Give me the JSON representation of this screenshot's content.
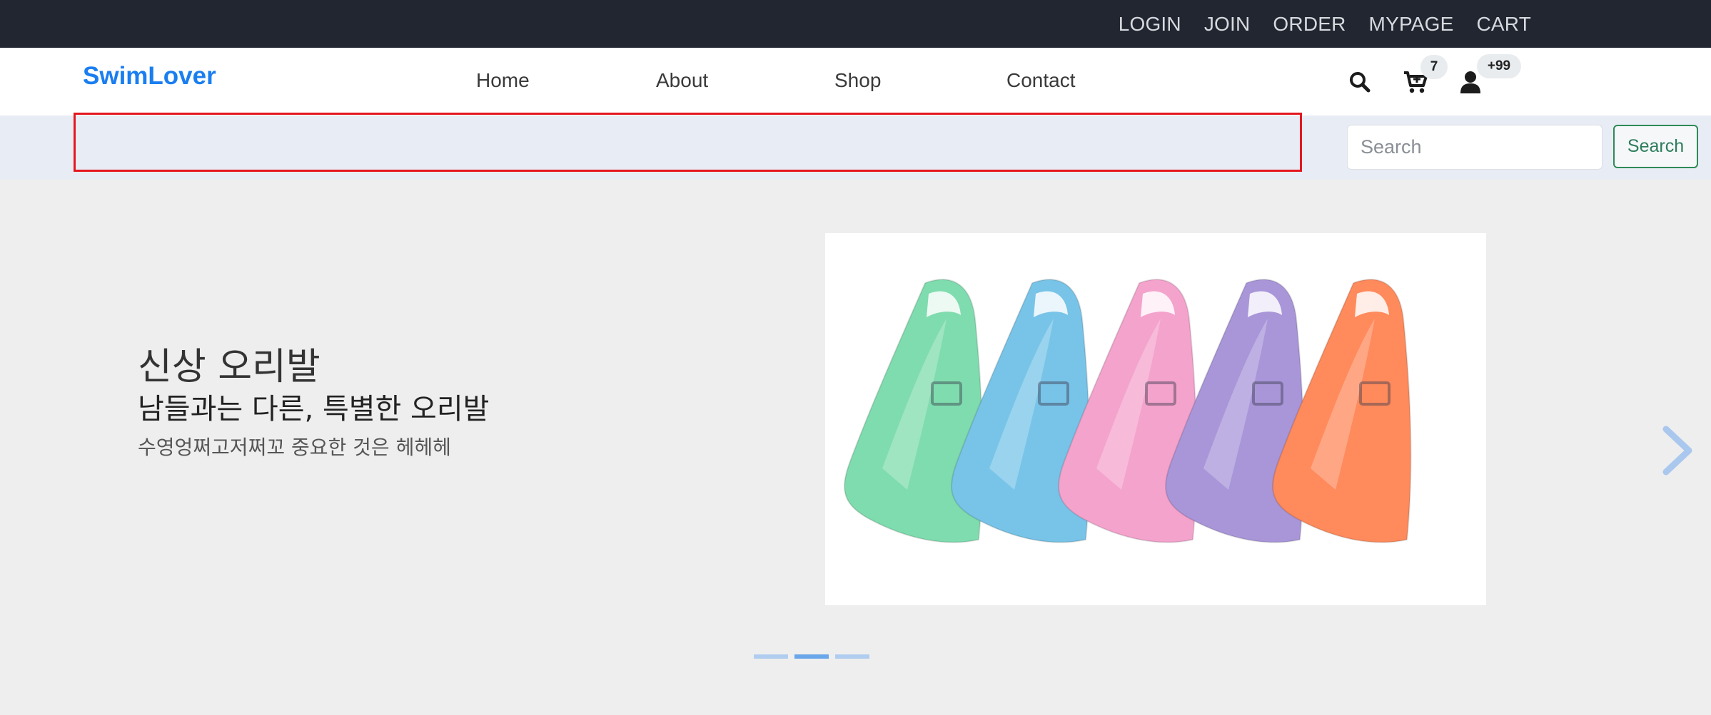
{
  "topbar": {
    "links": [
      "LOGIN",
      "JOIN",
      "ORDER",
      "MYPAGE",
      "CART"
    ]
  },
  "navbar": {
    "brand": "SwimLover",
    "menu": [
      "Home",
      "About",
      "Shop",
      "Contact"
    ],
    "cart_badge": "7",
    "user_badge": "+99",
    "icons": [
      "search-icon",
      "cart-icon",
      "user-icon"
    ]
  },
  "search": {
    "placeholder": "Search",
    "button_label": "Search"
  },
  "hero": {
    "title": "신상 오리발",
    "subtitle": "남들과는 다른, 특별한 오리발",
    "description": "수영엉쩌고저쩌꼬 중요한 것은 헤헤헤",
    "fin_colors": [
      "#7fdcae",
      "#78c4e8",
      "#f4a3cc",
      "#a996d9",
      "#ff8a5c"
    ],
    "active_slide": 2,
    "slide_count": 3
  },
  "colors": {
    "topbar_bg": "#212631",
    "brand": "#1a7ef0",
    "highlight": "#e5171f",
    "search_button": "#2e8b57"
  }
}
